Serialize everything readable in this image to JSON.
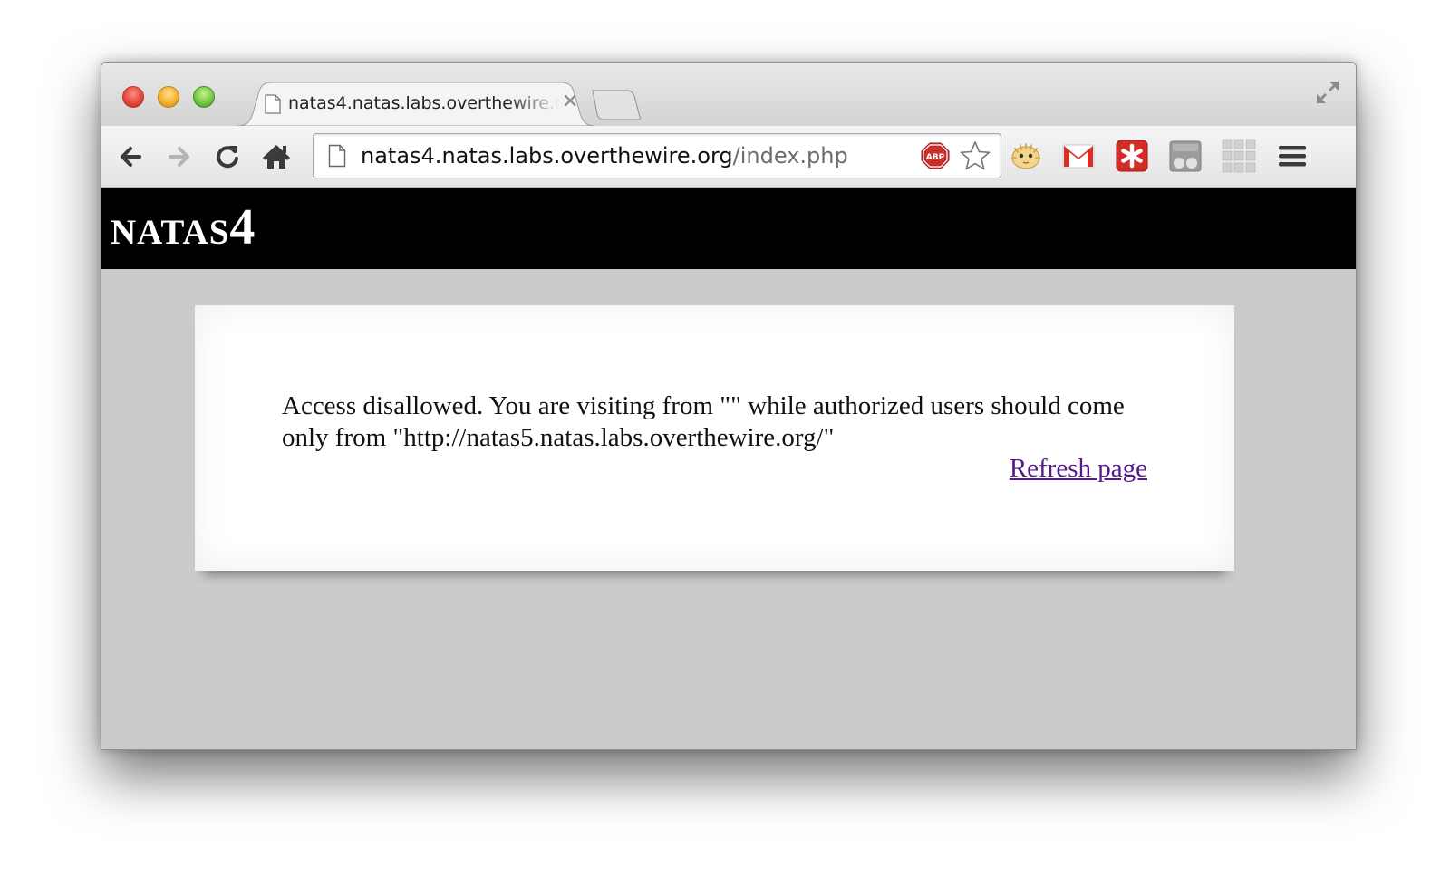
{
  "browser": {
    "tab": {
      "title": "natas4.natas.labs.overthewire.org",
      "close_glyph": "✕"
    },
    "address_bar": {
      "host": "natas4.natas.labs.overthewire.org",
      "path": "/index.php"
    },
    "extension_icons": [
      "adblock-plus-icon",
      "bookmark-star-icon",
      "pufferfish-extension-icon",
      "gmail-icon",
      "lastpass-icon",
      "extension-icon",
      "apps-grid-icon",
      "menu-icon"
    ]
  },
  "page": {
    "site_title_word": "NATAS",
    "site_title_number": "4",
    "message": "Access disallowed. You are visiting from \"\" while authorized users should come only from \"http://natas5.natas.labs.overthewire.org/\"",
    "refresh_link": "Refresh page"
  },
  "colors": {
    "header_bg": "#000000",
    "page_bg": "#cbcbcb",
    "card_bg": "#ffffff",
    "link": "#551a8b"
  }
}
